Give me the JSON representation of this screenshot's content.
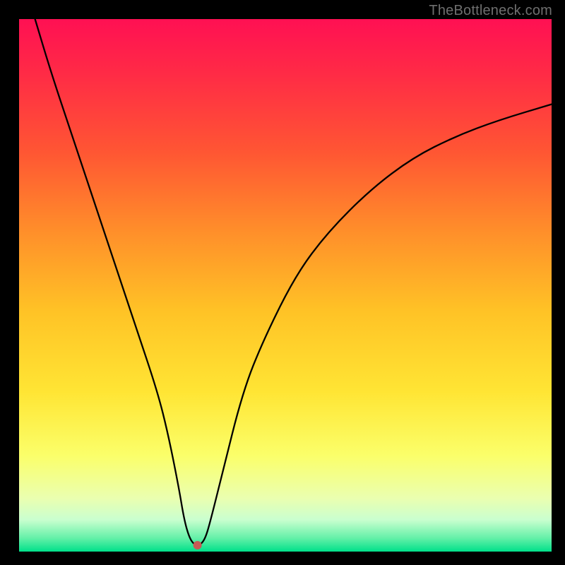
{
  "watermark": "TheBottleneck.com",
  "chart_data": {
    "type": "line",
    "title": "",
    "xlabel": "",
    "ylabel": "",
    "xlim": [
      0,
      100
    ],
    "ylim": [
      0,
      100
    ],
    "grid": false,
    "legend": false,
    "series": [
      {
        "name": "bottleneck-curve",
        "x": [
          3,
          6,
          10,
          14,
          18,
          22,
          26,
          28,
          30,
          31,
          32,
          33,
          34,
          35,
          36,
          38,
          42,
          46,
          52,
          58,
          66,
          74,
          82,
          90,
          100
        ],
        "y": [
          100,
          90,
          78,
          66,
          54,
          42,
          30,
          22,
          12,
          6,
          2.5,
          1.2,
          1.2,
          2.5,
          6,
          14,
          30,
          40,
          52,
          60,
          68,
          74,
          78,
          81,
          84
        ]
      }
    ],
    "marker": {
      "name": "optimal-point",
      "x": 33.5,
      "y": 1.2,
      "color": "#c75a56"
    },
    "gradient_stops": [
      {
        "offset": 0.0,
        "color": "#ff1053"
      },
      {
        "offset": 0.1,
        "color": "#ff2a46"
      },
      {
        "offset": 0.25,
        "color": "#ff5633"
      },
      {
        "offset": 0.4,
        "color": "#ff8f2a"
      },
      {
        "offset": 0.55,
        "color": "#ffc326"
      },
      {
        "offset": 0.7,
        "color": "#ffe534"
      },
      {
        "offset": 0.82,
        "color": "#fbff6a"
      },
      {
        "offset": 0.9,
        "color": "#eaffb0"
      },
      {
        "offset": 0.94,
        "color": "#caffcf"
      },
      {
        "offset": 0.975,
        "color": "#63f0a8"
      },
      {
        "offset": 1.0,
        "color": "#00e08a"
      }
    ]
  }
}
